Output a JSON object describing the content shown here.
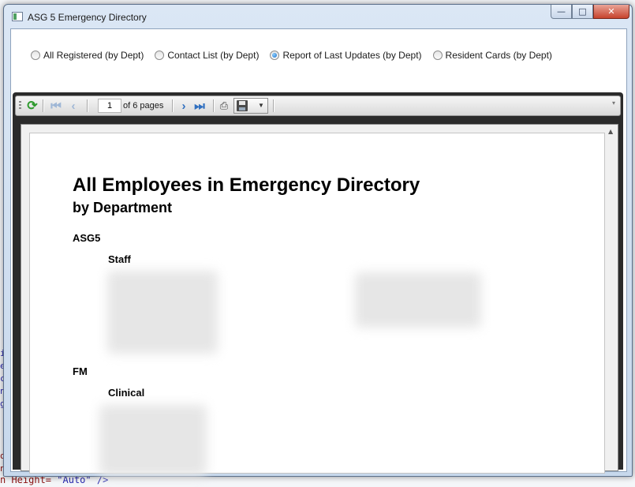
{
  "window": {
    "title": "ASG 5 Emergency Directory",
    "caption_buttons": {
      "minimize": "—",
      "maximize": "□",
      "close": "✕"
    }
  },
  "report_options": [
    {
      "label": "All Registered (by Dept)",
      "selected": false
    },
    {
      "label": "Contact List (by Dept)",
      "selected": false
    },
    {
      "label": "Report of Last Updates (by Dept)",
      "selected": true
    },
    {
      "label": "Resident Cards (by Dept)",
      "selected": false
    }
  ],
  "toolbar": {
    "refresh_icon": "refresh-icon",
    "page_value": "1",
    "page_total_text": "of 6 pages",
    "icons": [
      "first-page-icon",
      "prev-page-icon",
      "next-page-icon",
      "last-page-icon",
      "print-icon",
      "save-icon"
    ]
  },
  "report": {
    "title": "All Employees in Emergency Directory",
    "subtitle": "by Department",
    "sections": [
      {
        "dept": "ASG5",
        "group": "Staff"
      },
      {
        "dept": "FM",
        "group": "Clinical"
      }
    ]
  },
  "background": {
    "code_letters": [
      "i",
      "e",
      "c",
      "n",
      "g"
    ],
    "bottom_line_tag": "n Height=",
    "bottom_line_value": "\"Auto\" />",
    "bottom_letters": [
      "o",
      "n"
    ]
  },
  "colors": {
    "title_bar": "#dbe7f5",
    "close_button": "#c7432d",
    "viewer_frame": "#2b2b2b",
    "accent_blue": "#2f6fc0"
  }
}
